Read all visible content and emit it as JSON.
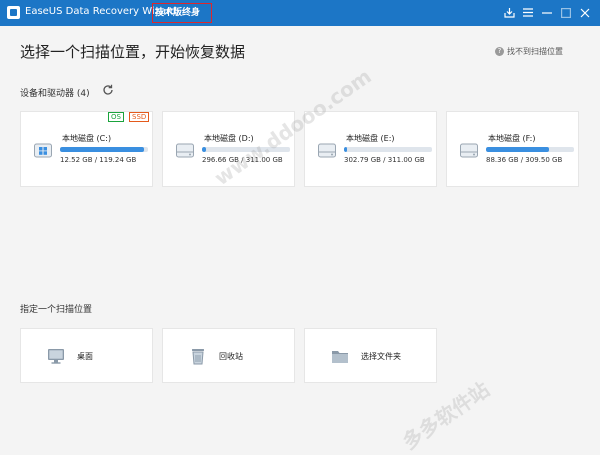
{
  "titlebar": {
    "app_title": "EaseUS Data Recovery Wizard",
    "edition": "技术版终身",
    "icons": [
      "export-icon",
      "menu-icon",
      "minimize-icon",
      "maximize-icon",
      "close-icon"
    ],
    "background_color": "#1c76c6"
  },
  "main": {
    "heading": "选择一个扫描位置，开始恢复数据",
    "help_link": "找不到扫描位置"
  },
  "devices": {
    "title": "设备和驱动器 (4)",
    "drives": [
      {
        "name": "本地磁盘 (C:)",
        "size": "12.52 GB / 119.24 GB",
        "usage_fraction": 0.95,
        "tags": [
          "OS",
          "SSD"
        ],
        "icon": "windows-drive-icon"
      },
      {
        "name": "本地磁盘 (D:)",
        "size": "296.66 GB / 311.00 GB",
        "usage_fraction": 0.05,
        "tags": [],
        "icon": "hard-drive-icon"
      },
      {
        "name": "本地磁盘 (E:)",
        "size": "302.79 GB / 311.00 GB",
        "usage_fraction": 0.03,
        "tags": [],
        "icon": "hard-drive-icon"
      },
      {
        "name": "本地磁盘 (F:)",
        "size": "88.36 GB / 309.50 GB",
        "usage_fraction": 0.72,
        "tags": [],
        "icon": "hard-drive-icon"
      }
    ],
    "bar_color": "#3a8fe0"
  },
  "locations": {
    "title": "指定一个扫描位置",
    "items": [
      {
        "label": "桌面",
        "icon": "desktop-icon"
      },
      {
        "label": "回收站",
        "icon": "recycle-bin-icon"
      },
      {
        "label": "选择文件夹",
        "icon": "folder-icon"
      }
    ]
  },
  "colors": {
    "accent": "#1c76c6",
    "os_tag": "#1aa33c",
    "ssd_tag": "#e45a1c",
    "badge_border": "#e0262a"
  }
}
